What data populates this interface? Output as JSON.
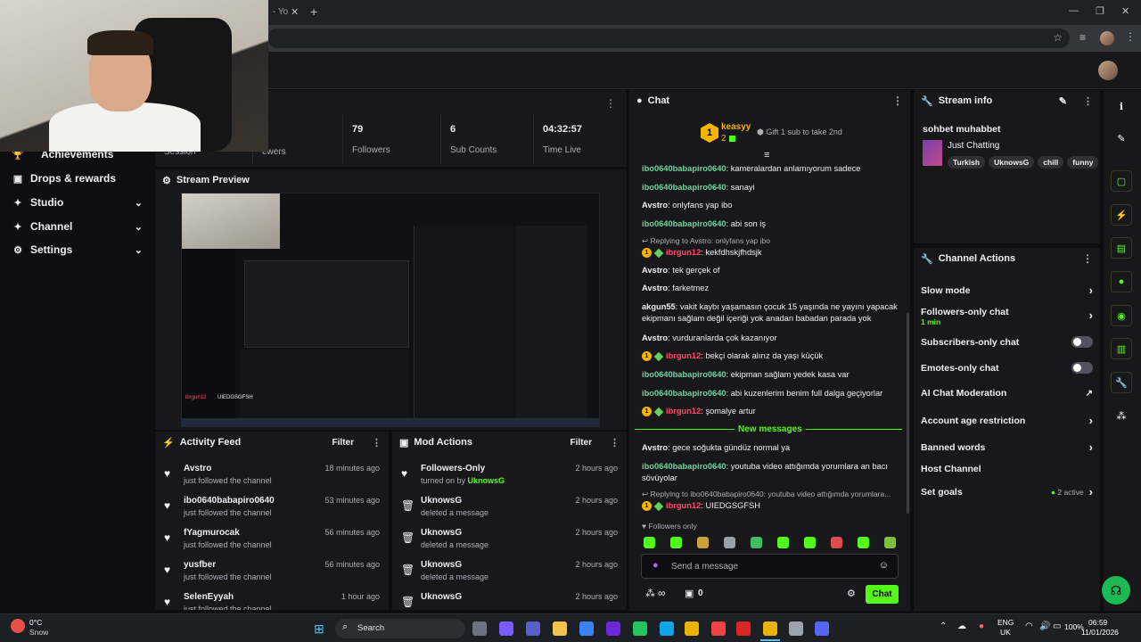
{
  "browser": {
    "tab_title": "- Yo",
    "new_tab": "+",
    "window_controls": [
      "—",
      "❐",
      "✕"
    ]
  },
  "sidebar": {
    "items": [
      {
        "label": "Achievements",
        "icon": "trophy-icon",
        "has_chevron": false
      },
      {
        "label": "Drops & rewards",
        "icon": "gift-icon",
        "has_chevron": false
      },
      {
        "label": "Studio",
        "icon": "studio-icon",
        "has_chevron": true
      },
      {
        "label": "Channel",
        "icon": "channel-icon",
        "has_chevron": true
      },
      {
        "label": "Settings",
        "icon": "gear-icon",
        "has_chevron": true
      }
    ]
  },
  "stats": {
    "session_label": "Session",
    "viewers_label": "ewers",
    "followers_value": "79",
    "followers_label": "Followers",
    "subs_value": "6",
    "subs_label": "Sub Counts",
    "time_value": "04:32:57",
    "time_label": "Time Live"
  },
  "preview": {
    "title": "Stream Preview",
    "chatter": "ibrgun12",
    "chatter_msg": "UIEDGSGFSH"
  },
  "activity_feed": {
    "title": "Activity Feed",
    "filter": "Filter",
    "rows": [
      {
        "name": "Avstro",
        "sub": "just followed the channel",
        "time": "18 minutes ago"
      },
      {
        "name": "ibo0640babapiro0640",
        "sub": "just followed the channel",
        "time": "53 minutes ago"
      },
      {
        "name": "fYagmurocak",
        "sub": "just followed the channel",
        "time": "56 minutes ago"
      },
      {
        "name": "yusfber",
        "sub": "just followed the channel",
        "time": "56 minutes ago"
      },
      {
        "name": "SelenEyyah",
        "sub": "just followed the channel",
        "time": "1 hour ago"
      }
    ]
  },
  "mod_actions": {
    "title": "Mod Actions",
    "filter": "Filter",
    "rows": [
      {
        "name": "Followers-Only",
        "sub": "turned on by ",
        "by": "UknowsG",
        "time": "2 hours ago",
        "icon": "heart-icon"
      },
      {
        "name": "UknowsG",
        "sub": "deleted a message",
        "by": "",
        "time": "2 hours ago",
        "icon": "trash-icon"
      },
      {
        "name": "UknowsG",
        "sub": "deleted a message",
        "by": "",
        "time": "2 hours ago",
        "icon": "trash-icon"
      },
      {
        "name": "UknowsG",
        "sub": "deleted a message",
        "by": "",
        "time": "2 hours ago",
        "icon": "trash-icon"
      },
      {
        "name": "UknowsG",
        "sub": "",
        "by": "",
        "time": "2 hours ago",
        "icon": "trash-icon"
      }
    ]
  },
  "chat": {
    "title": "Chat",
    "top_gifter": "keasyy",
    "top_gifter_count": "2",
    "gift_cta": "Gift 1 sub to take 2nd",
    "messages": [
      {
        "user": "ibo0640babapiro0640",
        "cls": "u-green",
        "text": "kameralardan anlamıyorum sadece",
        "badges": false
      },
      {
        "user": "ibo0640babapiro0640",
        "cls": "u-green",
        "text": "sanayi",
        "badges": false
      },
      {
        "user": "Avstro",
        "cls": "u-plain",
        "text": "onlyfans yap ibo",
        "badges": false
      },
      {
        "user": "ibo0640babapiro0640",
        "cls": "u-green",
        "text": "abi son iş",
        "badges": false
      },
      {
        "reply": "Replying to Avstro: onlyfans yap ibo"
      },
      {
        "user": "ibrgun12",
        "cls": "u-pink",
        "text": "kekfdhskjfhdsjk",
        "badges": true
      },
      {
        "user": "Avstro",
        "cls": "u-plain",
        "text": "tek gerçek of",
        "badges": false
      },
      {
        "user": "Avstro",
        "cls": "u-plain",
        "text": "farketmez",
        "badges": false
      },
      {
        "user": "akgun55",
        "cls": "u-plain",
        "text": "vakit kaybı yaşamasın çocuk 15 yaşında ne yayını yapacak ekipmanı sağlam değil içeriği yok anadan babadan parada yok",
        "badges": false
      },
      {
        "user": "Avstro",
        "cls": "u-plain",
        "text": "vurduranlarda çok kazanıyor",
        "badges": false
      },
      {
        "user": "ibrgun12",
        "cls": "u-pink",
        "text": "bekçi olarak alırız da yaşı küçük",
        "badges": true
      },
      {
        "user": "ibo0640babapiro0640",
        "cls": "u-green",
        "text": "ekipman sağlam yedek kasa var",
        "badges": false
      },
      {
        "user": "ibo0640babapiro0640",
        "cls": "u-green",
        "text": "abi kuzenlerim benim full dalga geçiyorlar",
        "badges": false
      },
      {
        "user": "ibrgun12",
        "cls": "u-pink",
        "text": "şomalye artur",
        "badges": true
      }
    ],
    "new_messages": "New messages",
    "new_msgs": [
      {
        "user": "Avstro",
        "cls": "u-plain",
        "text": "gece soğukta gündüz normal ya"
      },
      {
        "user": "ibo0640babapiro0640",
        "cls": "u-green",
        "text": "youtuba video attığımda yorumlara an bacı sövüyolar"
      }
    ],
    "reply2": "Replying to ibo0640babapiro0640: youtuba video attığımda yorumlara...",
    "last_user": "ibrgun12",
    "last_text": "UIEDGSGFSH",
    "followers_only": "Followers only",
    "input_placeholder": "Send a message",
    "infinity": "∞",
    "points": "0",
    "send_button": "Chat"
  },
  "stream_info": {
    "title": "Stream info",
    "stream_title": "sohbet muhabbet",
    "category": "Just Chatting",
    "tags": [
      "Turkish",
      "UknowsG",
      "chill",
      "funny"
    ]
  },
  "channel_actions": {
    "title": "Channel Actions",
    "slow_mode": "Slow mode",
    "followers_only": "Followers-only chat",
    "followers_only_sub": "1 min",
    "subscribers_only": "Subscribers-only chat",
    "emotes_only": "Emotes-only chat",
    "ai_moderation": "AI Chat Moderation",
    "age_restriction": "Account age restriction",
    "banned_words": "Banned words",
    "host_channel": "Host Channel",
    "set_goals": "Set goals",
    "goals_active": "2 active"
  },
  "taskbar": {
    "temp": "0°C",
    "weather": "Snow",
    "search": "Search",
    "lang1": "ENG",
    "lang2": "UK",
    "battery": "100%",
    "time": "06:59",
    "date": "11/01/2026"
  },
  "colors": {
    "accent": "#53fc18",
    "bg": "#0e0e10",
    "panel": "#18181b"
  }
}
